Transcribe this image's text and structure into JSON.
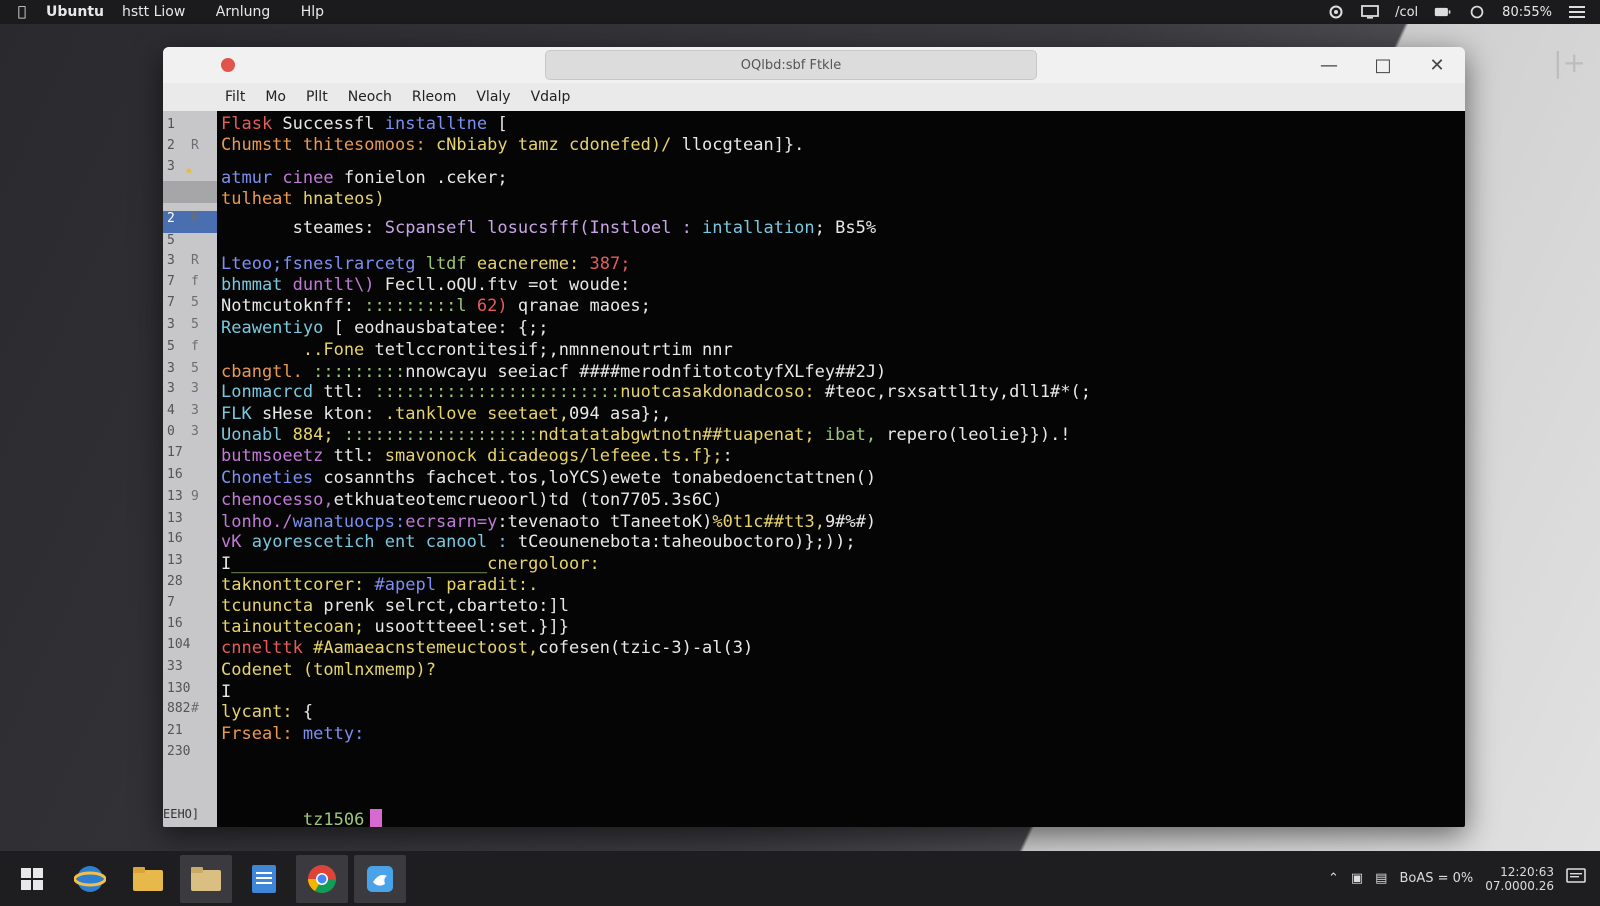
{
  "topbar": {
    "app": "Ubuntu",
    "menus": [
      "hstt Liow",
      "Arnlung",
      "Hlp"
    ],
    "status_text": "/col",
    "battery": "80:55%"
  },
  "window": {
    "title": "OQlbd:sbf Ftkle",
    "menu": [
      "Filt",
      "Mo",
      "Pllt",
      "Neoch",
      "Rleom",
      "Vlaly",
      "Vdalp"
    ]
  },
  "gutter": {
    "numbers": [
      "1",
      "2",
      "3",
      "",
      "2",
      "5",
      "3",
      "7",
      "7",
      "3",
      "5",
      "3",
      "3",
      "4",
      "0",
      "17",
      "16",
      "13",
      "13",
      "16",
      "13",
      "28",
      "7",
      "16",
      "104",
      "33",
      "130",
      "882",
      "21",
      "230"
    ],
    "marks": [
      "",
      "R",
      "",
      "",
      "6",
      "",
      "R",
      "f",
      "5",
      "5",
      "f",
      "5",
      "3",
      "3",
      "3",
      "",
      "",
      "9",
      "",
      "",
      "",
      "",
      "",
      "",
      "",
      "",
      "",
      "#",
      "",
      ""
    ],
    "status": "EEHO]"
  },
  "code_lines": [
    {
      "t": "Flask ",
      "c": "c-r",
      "rest": [
        {
          "t": "Successfl ",
          "c": "c-w"
        },
        {
          "t": "installtne",
          "c": "c-b"
        },
        {
          "t": " [",
          "c": "c-w"
        }
      ]
    },
    {
      "t": "Chumstt thitesomoos: ",
      "c": "c-o",
      "rest": [
        {
          "t": "cNbiaby tamz cdonefed)/ ",
          "c": "c-y"
        },
        {
          "t": "llocgtean]}.",
          "c": "c-w"
        }
      ]
    },
    {
      "t": "atmur ",
      "c": "c-b",
      "rest": [
        {
          "t": "cinee ",
          "c": "c-m"
        },
        {
          "t": "fonielon .ceker;",
          "c": "c-w"
        }
      ]
    },
    {
      "t": "tulheat ",
      "c": "c-o",
      "rest": [
        {
          "t": "hnateos)",
          "c": "c-y"
        }
      ]
    },
    {
      "t": "       steames: ",
      "c": "c-w",
      "rest": [
        {
          "t": "Scpansefl losucsfff(Instloel : ",
          "c": "c-p"
        },
        {
          "t": "intallation",
          "c": "c-c"
        },
        {
          "t": "; Bs5%",
          "c": "c-w"
        }
      ]
    },
    {
      "t": "Lteoo;fsneslrarcetg ",
      "c": "c-b",
      "rest": [
        {
          "t": "ltdf ",
          "c": "c-g"
        },
        {
          "t": "eacnereme: ",
          "c": "c-y"
        },
        {
          "t": "387;",
          "c": "c-r"
        }
      ]
    },
    {
      "t": "bhmmat ",
      "c": "c-c",
      "rest": [
        {
          "t": "duntlt\\) ",
          "c": "c-m"
        },
        {
          "t": "Fecll.oQU.ftv =ot woude:",
          "c": "c-w"
        }
      ]
    },
    {
      "t": "Notmcutoknff: ",
      "c": "c-w",
      "rest": [
        {
          "t": ":::::::::l ",
          "c": "c-g"
        },
        {
          "t": "62) ",
          "c": "c-r"
        },
        {
          "t": "qranae maoes;",
          "c": "c-w"
        }
      ]
    },
    {
      "t": "Reawentiyo ",
      "c": "c-c",
      "rest": [
        {
          "t": "[ eodnausbatatee: {;;",
          "c": "c-w"
        }
      ]
    },
    {
      "t": "        ..Fone ",
      "c": "c-y",
      "rest": [
        {
          "t": "tetlccrontitesif;,nmnnenoutrtim nnr",
          "c": "c-w"
        }
      ]
    },
    {
      "t": "cbangtl. ",
      "c": "c-o",
      "rest": [
        {
          "t": ":::::::::",
          "c": "c-g"
        },
        {
          "t": "nnowcayu seeiacf ####merodnfitotcotyfXLfey##2J)",
          "c": "c-w"
        }
      ]
    },
    {
      "t": "Lonmacrcd ",
      "c": "c-c",
      "rest": [
        {
          "t": "ttl: ",
          "c": "c-w"
        },
        {
          "t": "::::::::::::::::::::::::",
          "c": "c-g"
        },
        {
          "t": "nuotcasakdonadcoso: ",
          "c": "c-y"
        },
        {
          "t": "#teoc,rsxsattl1ty,dll1#*(;",
          "c": "c-w"
        }
      ]
    },
    {
      "t": "FLK ",
      "c": "c-c",
      "rest": [
        {
          "t": "sHese ",
          "c": "c-w"
        },
        {
          "t": "kton: ",
          "c": "c-w"
        },
        {
          "t": ".tanklove seetaet,",
          "c": "c-y"
        },
        {
          "t": "094 asa};,",
          "c": "c-w"
        }
      ]
    },
    {
      "t": "Uonabl ",
      "c": "c-c",
      "rest": [
        {
          "t": "884; ",
          "c": "c-y"
        },
        {
          "t": ":::::::::::::::::::",
          "c": "c-g"
        },
        {
          "t": "ndtatatabgwtnotn##tuapenat; ",
          "c": "c-y"
        },
        {
          "t": "ibat, ",
          "c": "c-g"
        },
        {
          "t": "repero(leolie}}).!",
          "c": "c-w"
        }
      ]
    },
    {
      "t": "butmsoeetz ",
      "c": "c-m",
      "rest": [
        {
          "t": "ttl: ",
          "c": "c-w"
        },
        {
          "t": "smavonock dicadeogs/lefeee.ts.f};",
          "c": "c-y"
        },
        {
          "t": ":",
          "c": "c-w"
        }
      ]
    },
    {
      "t": "Choneties ",
      "c": "c-b",
      "rest": [
        {
          "t": "cosannths fachcet.tos,loYCS)ewete tonabedoenctattnen(",
          "c": "c-w"
        },
        {
          "t": ")",
          "c": "c-w"
        }
      ]
    },
    {
      "t": "chenocesso,",
      "c": "c-m",
      "rest": [
        {
          "t": "etkhuateotemcrueoorl)td ",
          "c": "c-w"
        },
        {
          "t": "(ton7705.3s6C",
          "c": "c-w"
        },
        {
          "t": ")",
          "c": "c-w"
        }
      ]
    },
    {
      "t": "lonho./",
      "c": "c-m",
      "rest": [
        {
          "t": "wanatuocps:",
          "c": "c-b"
        },
        {
          "t": "ecrsarn=y",
          "c": "c-m"
        },
        {
          "t": ":",
          "c": "c-w"
        },
        {
          "t": "tevenaoto ",
          "c": "c-w"
        },
        {
          "t": "tTaneetoK)",
          "c": "c-w"
        },
        {
          "t": "%0t1c##tt3,",
          "c": "c-y"
        },
        {
          "t": "9#%#)",
          "c": "c-w"
        }
      ]
    },
    {
      "t": "vK ",
      "c": "c-m",
      "rest": [
        {
          "t": "ayorescetich ent canool : ",
          "c": "c-c"
        },
        {
          "t": "tCeounenebota:taheouboctoro)};",
          "c": "c-w"
        },
        {
          "t": "));",
          "c": "c-w"
        }
      ]
    },
    {
      "t": "I",
      "c": "c-w",
      "rest": [
        {
          "t": "_________________________",
          "c": "c-g"
        },
        {
          "t": "cnergoloor:",
          "c": "c-y"
        }
      ]
    },
    {
      "t": "taknonttcorer: ",
      "c": "c-y",
      "rest": [
        {
          "t": "#apepl ",
          "c": "c-b"
        },
        {
          "t": "paradit:.",
          "c": "c-y"
        }
      ]
    },
    {
      "t": "tcununcta ",
      "c": "c-y",
      "rest": [
        {
          "t": "prenk selrct,cbarteto:]l",
          "c": "c-w"
        }
      ]
    },
    {
      "t": "tainouttecoan; ",
      "c": "c-y",
      "rest": [
        {
          "t": "usoottteeel:set.}]",
          "c": "c-w"
        },
        {
          "t": "}",
          "c": "c-w"
        }
      ]
    },
    {
      "t": "cnnelttk ",
      "c": "c-r",
      "rest": [
        {
          "t": "#Aamaeacnstemeuctoost,",
          "c": "c-y"
        },
        {
          "t": "cofesen(tzic-3)-al(3)",
          "c": "c-w"
        }
      ]
    },
    {
      "t": "Codenet ",
      "c": "c-y",
      "rest": [
        {
          "t": "(tomlnxmemp)?",
          "c": "c-y"
        }
      ]
    },
    {
      "t": "I",
      "c": "c-w",
      "rest": []
    },
    {
      "t": "lycant: ",
      "c": "c-y",
      "rest": [
        {
          "t": "{",
          "c": "c-w"
        }
      ]
    },
    {
      "t": "Frseal: ",
      "c": "c-o",
      "rest": [
        {
          "t": "metty:",
          "c": "c-b"
        }
      ]
    }
  ],
  "prompt": {
    "text": "tz1506"
  },
  "taskbar": {
    "tray_text": "BoAS = 0%",
    "time": "1​2:20:63",
    "date": "07.0000.26"
  }
}
